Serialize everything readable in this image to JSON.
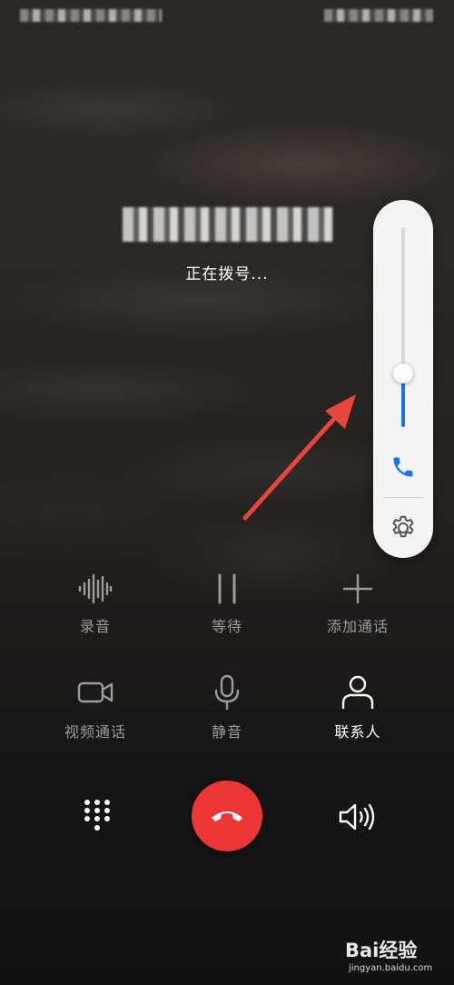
{
  "call": {
    "status": "正在拨号..."
  },
  "volume_panel": {
    "level": 0.27,
    "icons": [
      "phone-icon",
      "gear-icon"
    ]
  },
  "controls": {
    "row1": [
      {
        "label": "录音",
        "icon": "waveform-icon",
        "enabled": false
      },
      {
        "label": "等待",
        "icon": "pause-icon",
        "enabled": false
      },
      {
        "label": "添加通话",
        "icon": "plus-icon",
        "enabled": false
      }
    ],
    "row2": [
      {
        "label": "视频通话",
        "icon": "video-camera-icon",
        "enabled": false
      },
      {
        "label": "静音",
        "icon": "microphone-icon",
        "enabled": false
      },
      {
        "label": "联系人",
        "icon": "person-icon",
        "enabled": true
      }
    ]
  },
  "bottom_bar": {
    "icons": [
      "keypad-icon",
      "hang-up-icon",
      "speaker-icon"
    ]
  },
  "colors": {
    "accent_blue": "#1a73e8",
    "hangup_red": "#ee3535",
    "annotation_arrow": "#e8453c"
  },
  "watermark": {
    "brand": "Bai经验",
    "url": "jingyan.baidu.com"
  }
}
